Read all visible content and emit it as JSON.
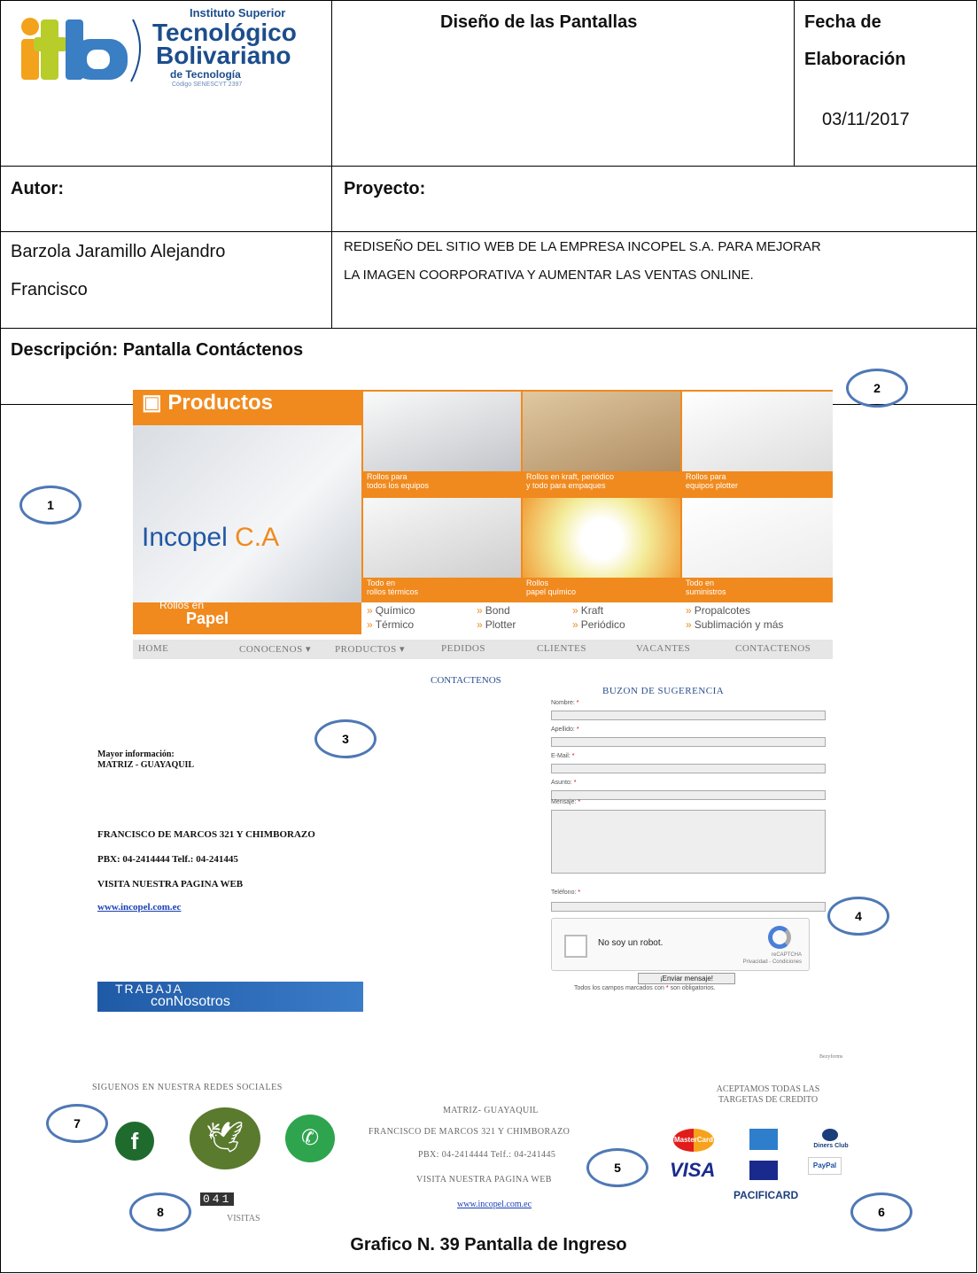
{
  "header": {
    "logo": {
      "line1": "Instituto Superior",
      "line2": "Tecnológico",
      "line3": "Bolivariano",
      "line4": "de Tecnología",
      "line5": "Código SENESCYT 2397",
      "mark": "itb"
    },
    "title": "Diseño de las Pantallas",
    "fecha_label_1": "Fecha de",
    "fecha_label_2": "Elaboración",
    "fecha_value": "03/11/2017"
  },
  "row2": {
    "autor_label": "Autor:",
    "proyecto_label": "Proyecto:"
  },
  "row3": {
    "autor_line1": "Barzola Jaramillo Alejandro",
    "autor_line2": "Francisco",
    "proyecto_line1": "REDISEÑO DEL SITIO WEB DE LA EMPRESA INCOPEL S.A. PARA MEJORAR",
    "proyecto_line2": "LA IMAGEN COORPORATIVA Y AUMENTAR LAS VENTAS ONLINE."
  },
  "descripcion": "Descripción: Pantalla Contáctenos",
  "screenshot": {
    "banner": {
      "productos": "Productos",
      "brand_a": "Incopel",
      "brand_b": "C.A",
      "rollos_en": "Rollos en",
      "papel": "Papel",
      "tiles": [
        {
          "line1": "Rollos para",
          "line2": "todos los equipos"
        },
        {
          "line1": "Rollos en kraft, periódico",
          "line2": "y todo para empaques"
        },
        {
          "line1": "Rollos para",
          "line2": "equipos plotter"
        },
        {
          "line1": "Todo en",
          "line2": "rollos térmicos"
        },
        {
          "line1": "Rollos",
          "line2": "papel químico"
        },
        {
          "line1": "Todo en",
          "line2": "suministros"
        }
      ],
      "categories": [
        "Químico",
        "Bond",
        "Kraft",
        "Propalcotes",
        "Térmico",
        "Plotter",
        "Periódico",
        "Sublimación y más"
      ]
    },
    "nav": [
      "HOME",
      "CONOCENOS ▾",
      "PRODUCTOS ▾",
      "PEDIDOS",
      "CLIENTES",
      "VACANTES",
      "CONTACTENOS"
    ],
    "contact_title": "CONTACTENOS",
    "buzon_title": "BUZON DE SUGERENCIA",
    "form_labels": [
      "Nombre:",
      "Apellido:",
      "E-Mail:",
      "Asunto:",
      "Mensaje:",
      "Teléfono:"
    ],
    "required_mark": "*",
    "captcha_text": "No soy un robot.",
    "captcha_brand": "reCAPTCHA",
    "captcha_links": "Privacidad - Condiciones",
    "send_button": "¡Enviar mensaje!",
    "note_before": "Todos los campos marcados con",
    "note_after": "son obligatorios.",
    "info": {
      "line1": "Mayor información:",
      "line2": "MATRIZ - GUAYAQUIL",
      "address": "FRANCISCO DE MARCOS 321 Y CHIMBORAZO",
      "phones": "PBX: 04-2414444 Telf.: 04-241445",
      "visit": "VISITA NUESTRA PAGINA WEB",
      "web": "www.incopel.com.ec"
    },
    "trabaja_a": "TRABAJA",
    "trabaja_b": "conNosotros",
    "small_footer": "Bezyforms",
    "social_title": "SIGUENOS EN NUESTRA REDES SOCIALES",
    "counter": "041",
    "visitas": "VISITAS",
    "footer": {
      "matriz": "MATRIZ- GUAYAQUIL",
      "address": "FRANCISCO DE MARCOS 321 Y CHIMBORAZO",
      "phones": "PBX: 04-2414444 Telf.: 04-241445",
      "visit": "VISITA NUESTRA PAGINA WEB",
      "web": "www.incopel.com.ec"
    },
    "aceptamos_1": "ACEPTAMOS TODAS LAS",
    "aceptamos_2": "TARGETAS DE CREDITO",
    "cards": [
      "MasterCard",
      "Diners Club",
      "VISA",
      "PayPal",
      "PACIFICARD"
    ]
  },
  "markers": [
    "1",
    "2",
    "3",
    "4",
    "5",
    "6",
    "7",
    "8"
  ],
  "caption": "Grafico N.  39 Pantalla de Ingreso",
  "colors": {
    "orange": "#f08a1e",
    "blue_logo": "#1c4d8c",
    "marker_ring": "#4e78b5"
  }
}
